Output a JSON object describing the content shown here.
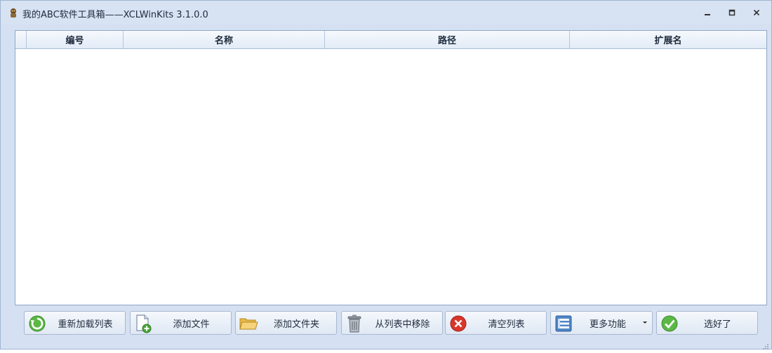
{
  "window": {
    "title": "我的ABC软件工具箱——XCLWinKits  3.1.0.0",
    "icon": "app-logo-icon",
    "controls": {
      "minimize": "minimize-icon",
      "restore": "restore-icon",
      "close": "close-icon"
    }
  },
  "grid": {
    "columns": [
      "编号",
      "名称",
      "路径",
      "扩展名"
    ],
    "rows": []
  },
  "toolbar": {
    "buttons": [
      {
        "label": "重新加载列表",
        "icon": "reload-icon"
      },
      {
        "label": "添加文件",
        "icon": "add-file-icon"
      },
      {
        "label": "添加文件夹",
        "icon": "folder-icon"
      },
      {
        "label": "从列表中移除",
        "icon": "trash-icon"
      },
      {
        "label": "清空列表",
        "icon": "clear-icon"
      },
      {
        "label": "更多功能",
        "icon": "list-icon"
      },
      {
        "label": "选好了",
        "icon": "check-icon"
      }
    ]
  },
  "colors": {
    "window_bg": "#d5e1f2",
    "grid_header": "#e2ebf7",
    "accent_green": "#4aa83a",
    "accent_red": "#d9362b"
  }
}
